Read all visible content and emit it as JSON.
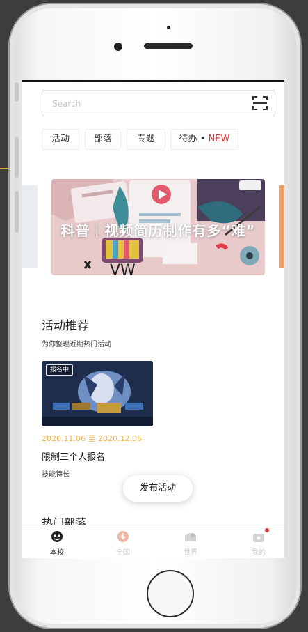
{
  "search": {
    "placeholder": "Search"
  },
  "tabs": [
    {
      "label": "活动"
    },
    {
      "label": "部落"
    },
    {
      "label": "专题"
    },
    {
      "label": "待办 • ",
      "badge": "NEW"
    }
  ],
  "banner": {
    "title": "科普｜视频简历制作有多“难”"
  },
  "activity": {
    "title": "活动推荐",
    "subtitle": "为你整理近期热门活动",
    "card": {
      "badge": "报名中",
      "date": "2020.11.06 至 2020.12.06",
      "title": "限制三个人报名",
      "tag": "技能特长"
    }
  },
  "fab": {
    "label": "发布活动"
  },
  "hot_tribes": {
    "title": "热门部落"
  },
  "tabbar": [
    {
      "label": "本校",
      "active": true,
      "icon": "school-icon"
    },
    {
      "label": "全国",
      "active": false,
      "icon": "nation-icon"
    },
    {
      "label": "世界",
      "active": false,
      "icon": "world-icon"
    },
    {
      "label": "我的",
      "active": false,
      "icon": "profile-icon"
    }
  ],
  "colors": {
    "accent": "#e53935",
    "date": "#f0b44a",
    "callout": "#d9a23f",
    "background": "#3d3d3d"
  }
}
